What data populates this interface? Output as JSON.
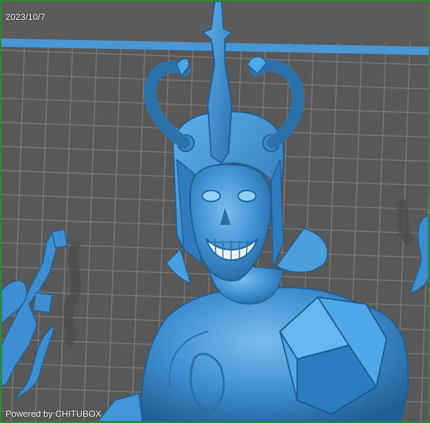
{
  "overlay": {
    "date_label": "2023/10/7",
    "powered_label": "Powered by CHITUBOX"
  },
  "colors": {
    "frame_border": "#2e8b2e",
    "background": "#595959",
    "grid_line": "#7a7a7a",
    "model_blue": "#3d8fd1",
    "model_highlight": "#6fb6ec",
    "model_shadow": "#1f5f93",
    "platform_edge": "#4a97d6"
  },
  "model": {
    "icon": "figure-helmet-snakes-icon"
  }
}
